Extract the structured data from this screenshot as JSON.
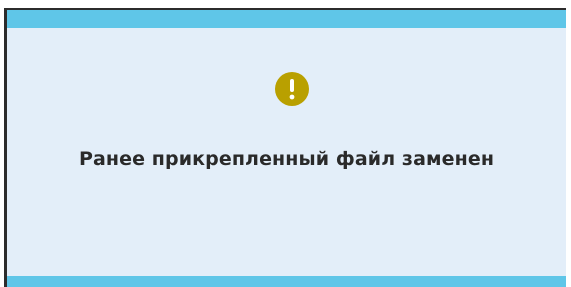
{
  "notification": {
    "icon": "warning-exclamation-icon",
    "accent_color": "#b9a000",
    "bar_color": "#5fc6e8",
    "background_color": "#e3eef9",
    "message": "Ранее прикрепленный файл заменен"
  }
}
